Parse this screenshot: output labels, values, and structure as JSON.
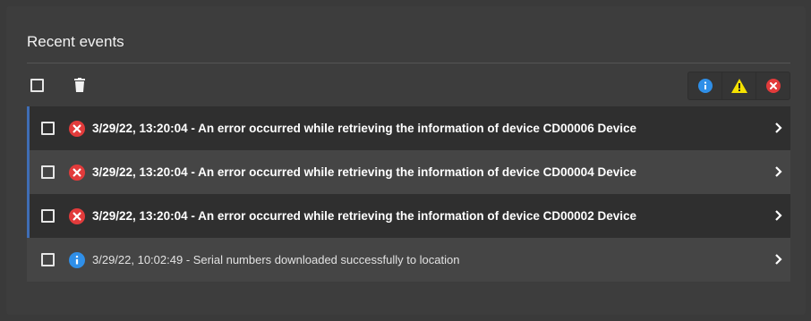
{
  "panel": {
    "title": "Recent events"
  },
  "toolbar": {
    "icons": [
      "select-all-checkbox",
      "trash-icon"
    ],
    "filters": [
      {
        "name": "info-filter",
        "icon": "info-icon",
        "color": "#2f8fe8"
      },
      {
        "name": "warning-filter",
        "icon": "warning-icon",
        "color": "#f5e100"
      },
      {
        "name": "error-filter",
        "icon": "error-icon",
        "color": "#e23b3b"
      }
    ]
  },
  "events": [
    {
      "severity": "error",
      "text": "3/29/22, 13:20:04 - An error occurred while retrieving the information of device CD00006 Device"
    },
    {
      "severity": "error",
      "text": "3/29/22, 13:20:04 - An error occurred while retrieving the information of device CD00004 Device"
    },
    {
      "severity": "error",
      "text": "3/29/22, 13:20:04 - An error occurred while retrieving the information of device CD00002 Device"
    },
    {
      "severity": "info",
      "text": "3/29/22, 10:02:49 - Serial numbers downloaded successfully to location"
    }
  ],
  "colors": {
    "accent": "#3f6db5",
    "error": "#e23b3b",
    "info": "#2f8fe8",
    "warning": "#f5e100"
  }
}
